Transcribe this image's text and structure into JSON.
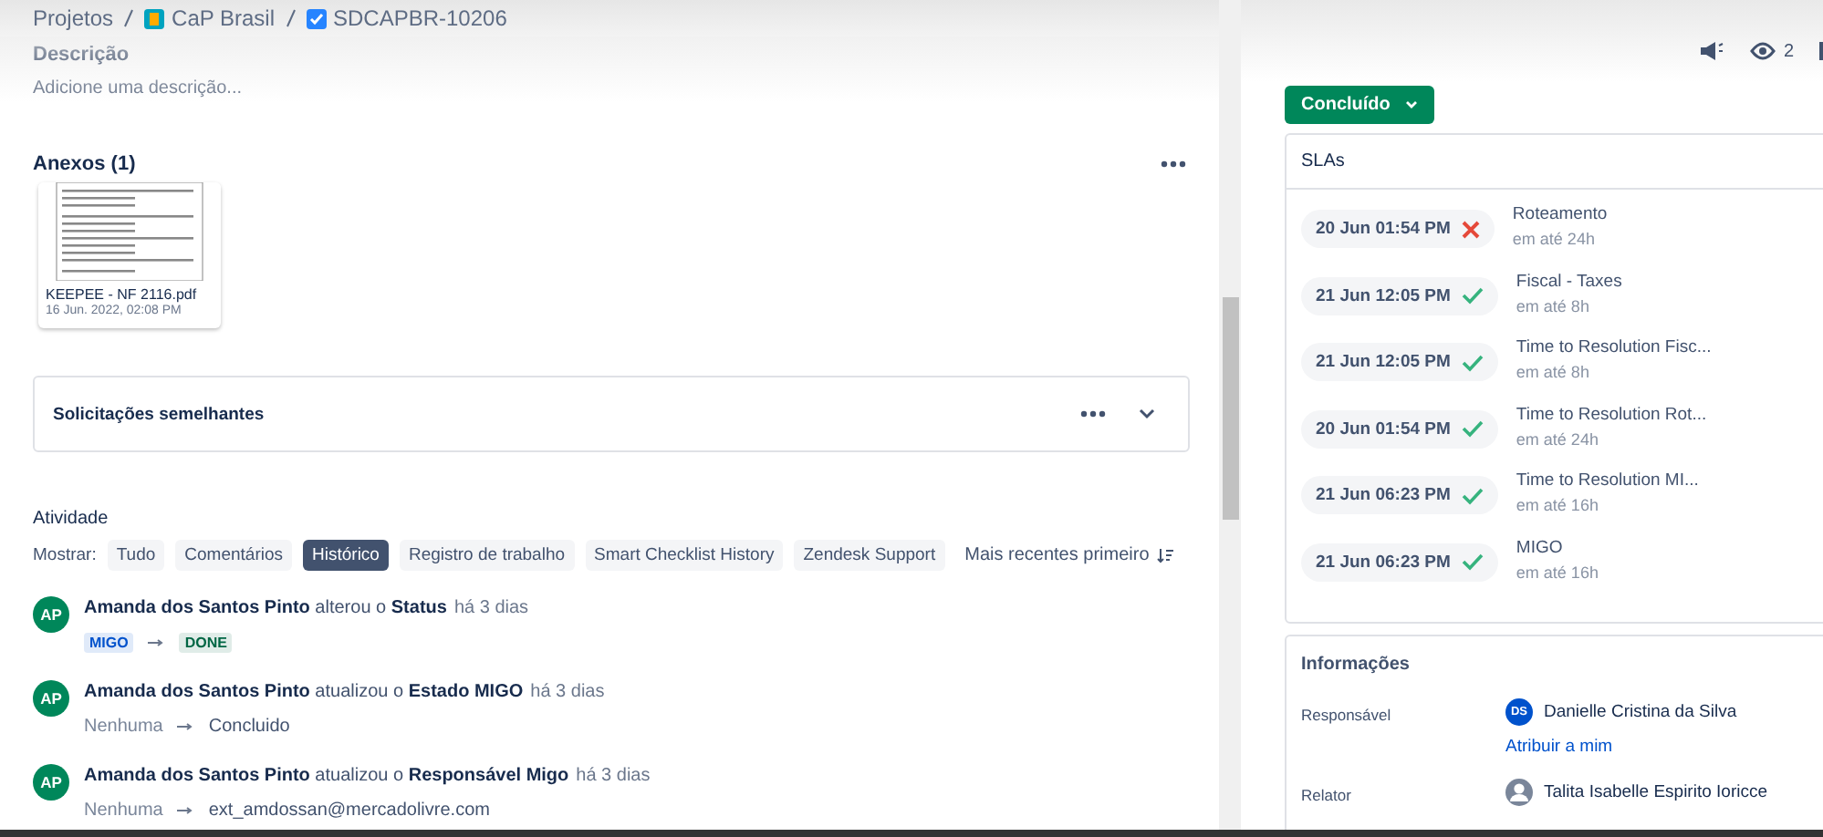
{
  "breadcrumbs": [
    {
      "label": "Projetos",
      "kind": "text"
    },
    {
      "label": "CaP Brasil",
      "kind": "project"
    },
    {
      "label": "SDCAPBR-10206",
      "kind": "issue"
    }
  ],
  "description": {
    "heading": "Descrição",
    "placeholder": "Adicione uma descrição..."
  },
  "attachments": {
    "heading": "Anexos (1)",
    "files": [
      {
        "name": "KEEPEE - NF 2116.pdf",
        "date": "16 Jun. 2022, 02:08 PM"
      }
    ]
  },
  "similar": {
    "title": "Solicitações semelhantes"
  },
  "activity": {
    "heading": "Atividade",
    "show_label": "Mostrar:",
    "sort": "Mais recentes primeiro",
    "filters": [
      {
        "label": "Tudo",
        "selected": false
      },
      {
        "label": "Comentários",
        "selected": false
      },
      {
        "label": "Histórico",
        "selected": true
      },
      {
        "label": "Registro de trabalho",
        "selected": false
      },
      {
        "label": "Smart Checklist History",
        "selected": false
      },
      {
        "label": "Zendesk Support",
        "selected": false
      }
    ],
    "entries": [
      {
        "avatar": "AP",
        "author": "Amanda dos Santos Pinto",
        "action": "alterou o",
        "field": "Status",
        "time": "há 3 dias",
        "from": {
          "text": "MIGO",
          "kind": "lozenge",
          "color": "#0052cc"
        },
        "to": {
          "text": "DONE",
          "kind": "lozenge",
          "color": "#006644"
        }
      },
      {
        "avatar": "AP",
        "author": "Amanda dos Santos Pinto",
        "action": "atualizou o",
        "field": "Estado MIGO",
        "time": "há 3 dias",
        "from": {
          "text": "Nenhuma",
          "kind": "muted"
        },
        "to": {
          "text": "Concluido",
          "kind": "plain"
        }
      },
      {
        "avatar": "AP",
        "author": "Amanda dos Santos Pinto",
        "action": "atualizou o",
        "field": "Responsável Migo",
        "time": "há 3 dias",
        "from": {
          "text": "Nenhuma",
          "kind": "muted"
        },
        "to": {
          "text": "ext_amdossan@mercadolivre.com",
          "kind": "plain"
        }
      }
    ]
  },
  "watchers": {
    "count": "2"
  },
  "status_button": {
    "label": "Concluído"
  },
  "slas": {
    "title": "SLAs",
    "items": [
      {
        "time": "20 Jun 01:54 PM",
        "met": false,
        "name": "Roteamento",
        "goal": "em até 24h"
      },
      {
        "time": "21 Jun 12:05 PM",
        "met": true,
        "name": "Fiscal - Taxes",
        "goal": "em até 8h"
      },
      {
        "time": "21 Jun 12:05 PM",
        "met": true,
        "name": "Time to Resolution Fisc...",
        "goal": "em até 8h"
      },
      {
        "time": "20 Jun 01:54 PM",
        "met": true,
        "name": "Time to Resolution Rot...",
        "goal": "em até 24h"
      },
      {
        "time": "21 Jun 06:23 PM",
        "met": true,
        "name": "Time to Resolution MI...",
        "goal": "em até 16h"
      },
      {
        "time": "21 Jun 06:23 PM",
        "met": true,
        "name": "MIGO",
        "goal": "em até 16h"
      }
    ]
  },
  "details": {
    "title": "Informações",
    "fields": [
      {
        "label": "Responsável",
        "kind": "user",
        "avatar": "DS",
        "value": "Danielle Cristina da Silva",
        "action": "Atribuir a mim"
      },
      {
        "label": "Relator",
        "kind": "default-user",
        "value": "Talita Isabelle Espirito Ioricce"
      }
    ]
  }
}
